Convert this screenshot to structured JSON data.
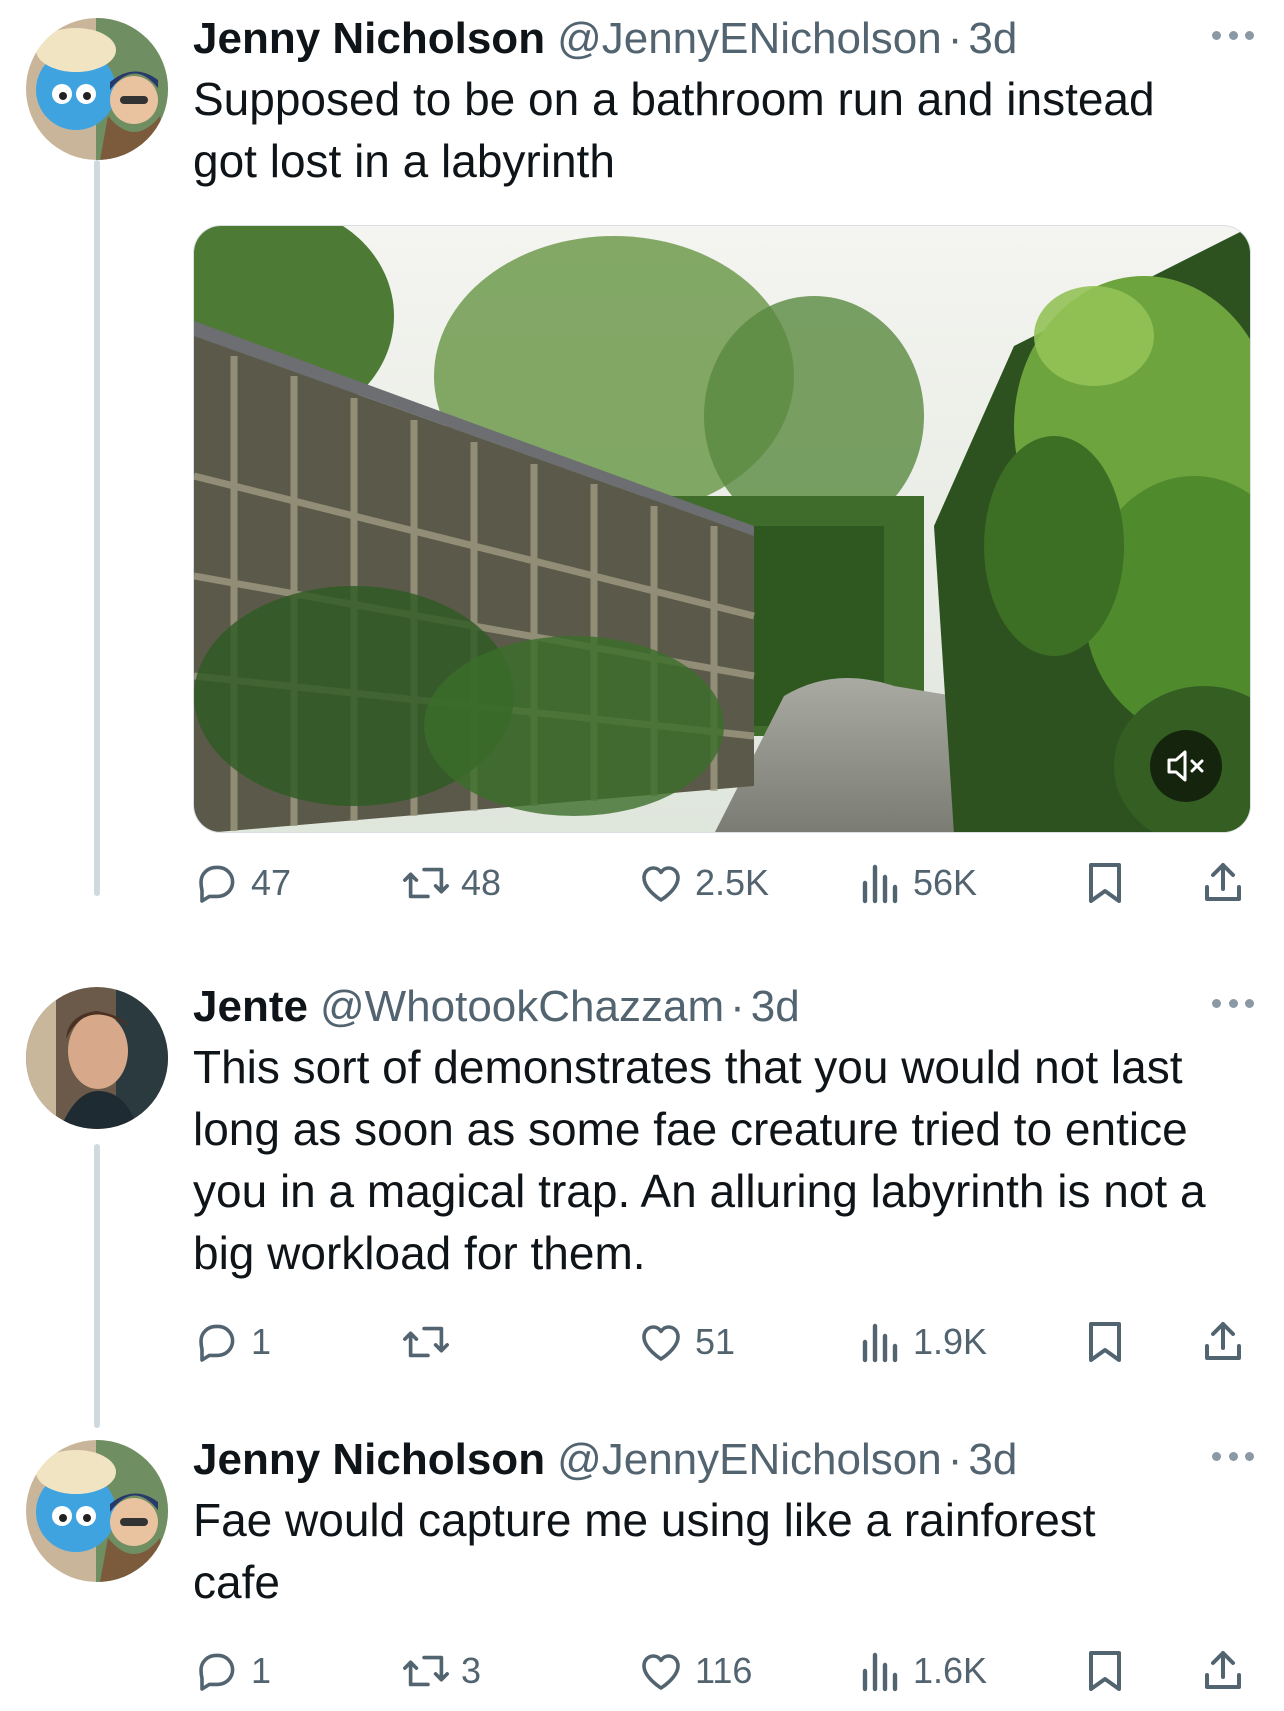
{
  "tweets": [
    {
      "name": "Jenny Nicholson",
      "handle": "@JennyENicholson",
      "separator": "·",
      "time": "3d",
      "text": "Supposed to be on a bathroom run and instead got lost in a labyrinth",
      "media": {
        "type": "video",
        "subject": "hedge maze with wooden lattice fence",
        "muted_icon": "speaker-muted-icon"
      },
      "stats": {
        "replies": "47",
        "reposts": "48",
        "likes": "2.5K",
        "views": "56K"
      }
    },
    {
      "name": "Jente",
      "handle": "@WhotookChazzam",
      "separator": "·",
      "time": "3d",
      "text": "This sort of demonstrates that you would not last long as soon as some fae creature tried to entice you in a magical trap. An alluring labyrinth is not a big workload for them.",
      "stats": {
        "replies": "1",
        "reposts": "",
        "likes": "51",
        "views": "1.9K"
      }
    },
    {
      "name": "Jenny Nicholson",
      "handle": "@JennyENicholson",
      "separator": "·",
      "time": "3d",
      "text": "Fae would capture me using like a rainforest cafe",
      "stats": {
        "replies": "1",
        "reposts": "3",
        "likes": "116",
        "views": "1.6K"
      }
    }
  ],
  "colors": {
    "text": "#0f1419",
    "secondary": "#536471",
    "thread_line": "#cfd9de"
  },
  "icons": [
    "reply-icon",
    "repost-icon",
    "like-icon",
    "views-icon",
    "bookmark-icon",
    "share-icon",
    "more-icon"
  ]
}
